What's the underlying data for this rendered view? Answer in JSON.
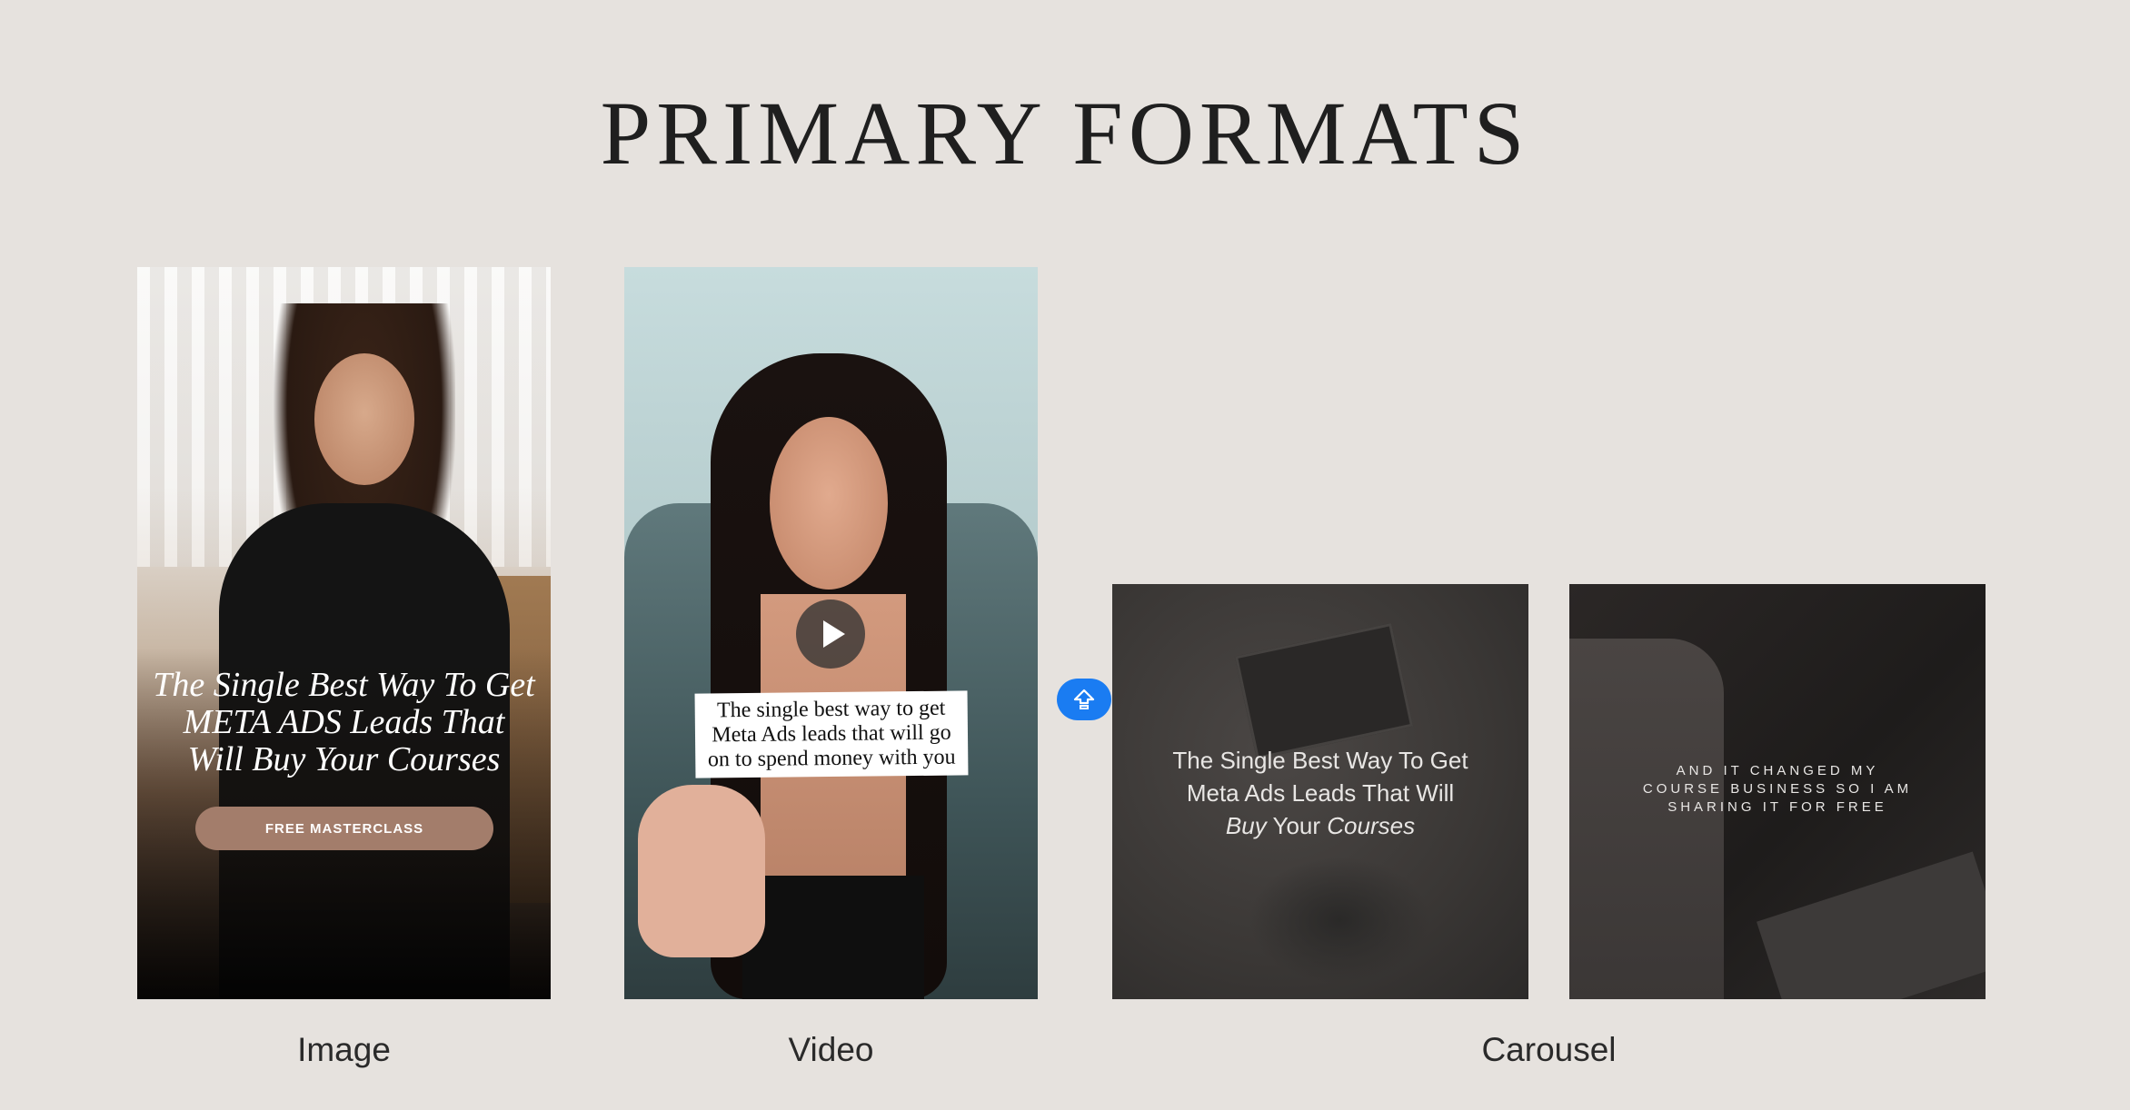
{
  "title": "PRIMARY FORMATS",
  "image_card": {
    "headline_line1": "The Single Best Way To Get",
    "headline_line2": "META ADS Leads That",
    "headline_line3": "Will Buy Your Courses",
    "cta_label": "FREE MASTERCLASS",
    "label": "Image"
  },
  "video_card": {
    "caption_line1": "The single best way to get",
    "caption_line2": "Meta Ads leads that will go",
    "caption_line3": "on to spend money with you",
    "play_icon": "play-icon",
    "label": "Video"
  },
  "upload_badge": {
    "icon": "upload-icon",
    "color": "#1a7cf2"
  },
  "carousel": {
    "slide1_line1": "The Single Best Way To Get",
    "slide1_line2": "Meta Ads Leads That Will",
    "slide1_line3_italic_a": "Buy",
    "slide1_line3_normal": " Your ",
    "slide1_line3_italic_b": "Courses",
    "slide2_line1": "AND IT CHANGED MY",
    "slide2_line2": "COURSE BUSINESS SO I AM",
    "slide2_line3": "SHARING IT FOR FREE",
    "label": "Carousel"
  },
  "colors": {
    "background": "#e6e2de",
    "cta": "#a37d6b",
    "accent_blue": "#1a7cf2"
  }
}
